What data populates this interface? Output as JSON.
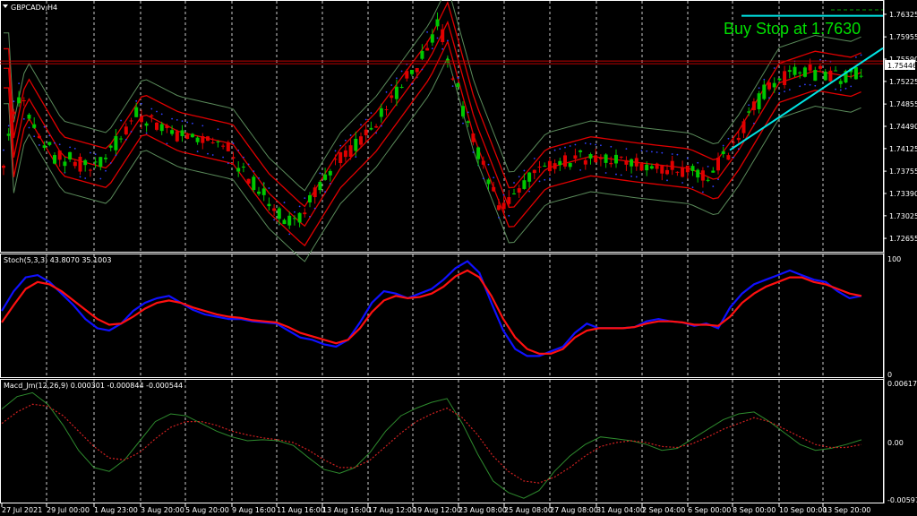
{
  "window": {
    "symbol_title": "GBPCADv,H4"
  },
  "annotation": {
    "text": "Buy Stop at 1.7630",
    "color": "#00e000"
  },
  "colors": {
    "bull": "#00c800",
    "bear": "#e00000",
    "bands_mid": "#e00000",
    "bands_outer": "#5a8a5a",
    "psar": "#3040ff",
    "trendline": "#00e5e5",
    "stoch_main": "#1010ff",
    "stoch_signal": "#ff1010",
    "grid": "#ffffff"
  },
  "chart_data": [
    {
      "type": "candlestick",
      "title": "GBPCADv,H4",
      "y_ticks": [
        "1.76325",
        "1.75955",
        "1.75590",
        "1.75225",
        "1.74855",
        "1.74490",
        "1.74125",
        "1.73755",
        "1.73390",
        "1.73025",
        "1.72655"
      ],
      "ylim": [
        1.7248,
        1.765
      ],
      "current_price": "1.75446",
      "resistance": 1.7556,
      "buy_stop": 1.763,
      "x_tick_labels": [
        "27 Jul 2021",
        "29 Jul 00:00",
        "1 Aug 23:00",
        "3 Aug 20:00",
        "5 Aug 20:00",
        "9 Aug 16:00",
        "11 Aug 16:00",
        "13 Aug 16:00",
        "17 Aug 12:00",
        "19 Aug 12:00",
        "23 Aug 08:00",
        "25 Aug 08:00",
        "27 Aug 08:00",
        "31 Aug 04:00",
        "2 Sep 04:00",
        "6 Sep 00:00",
        "8 Sep 00:00",
        "10 Sep 00:00",
        "13 Sep 20:00"
      ],
      "trendline": {
        "from": [
          "8 Sep 00:00",
          1.741
        ],
        "to": [
          "13 Sep 20:00",
          1.7562
        ]
      },
      "indicators": [
        "Bollinger Bands",
        "Parabolic SAR"
      ]
    },
    {
      "type": "line",
      "title": "Stoch(5,3,3) 43.8070 35.1003",
      "y_ticks": [
        "100",
        "0"
      ],
      "ylim": [
        0,
        100
      ],
      "series": [
        {
          "name": "main",
          "values": [
            55,
            72,
            84,
            86,
            80,
            70,
            60,
            48,
            40,
            38,
            44,
            55,
            62,
            66,
            68,
            62,
            56,
            52,
            50,
            48,
            48,
            46,
            45,
            44,
            38,
            32,
            30,
            26,
            24,
            30,
            45,
            62,
            72,
            70,
            66,
            70,
            74,
            82,
            92,
            98,
            88,
            62,
            38,
            22,
            16,
            16,
            20,
            24,
            36,
            44,
            40,
            40,
            40,
            41,
            46,
            48,
            46,
            45,
            42,
            44,
            40,
            58,
            70,
            78,
            82,
            86,
            90,
            86,
            82,
            80,
            72,
            66,
            68
          ]
        },
        {
          "name": "signal",
          "values": [
            45,
            60,
            74,
            80,
            78,
            72,
            64,
            56,
            48,
            43,
            44,
            50,
            57,
            62,
            64,
            62,
            58,
            55,
            52,
            50,
            49,
            47,
            46,
            45,
            41,
            36,
            33,
            30,
            27,
            30,
            40,
            54,
            64,
            68,
            66,
            67,
            70,
            76,
            85,
            90,
            84,
            68,
            48,
            32,
            22,
            18,
            18,
            22,
            32,
            38,
            40,
            40,
            40,
            41,
            44,
            46,
            46,
            45,
            43,
            43,
            42,
            50,
            62,
            70,
            76,
            80,
            84,
            84,
            80,
            78,
            74,
            70,
            68
          ]
        }
      ]
    },
    {
      "type": "line",
      "title": "Macd_Jm(12,26,9) 0.000301 -0.000844 -0.000544",
      "y_ticks": [
        "0.006176",
        "0.00",
        "-0.00597"
      ],
      "ylim": [
        -0.00597,
        0.006176
      ],
      "series": [
        {
          "name": "macd",
          "values": [
            0.0035,
            0.0048,
            0.0052,
            0.004,
            0.0018,
            -0.0008,
            -0.0026,
            -0.003,
            -0.0018,
            0.0002,
            0.0022,
            0.003,
            0.0028,
            0.002,
            0.0012,
            0.0006,
            0.0002,
            0.0003,
            0.0002,
            -0.0003,
            -0.0016,
            -0.0028,
            -0.0032,
            -0.0026,
            -0.001,
            0.0012,
            0.0028,
            0.0036,
            0.0042,
            0.0046,
            0.002,
            -0.0012,
            -0.004,
            -0.0052,
            -0.0058,
            -0.005,
            -0.003,
            -0.0014,
            -0.0002,
            0.0006,
            0.0004,
            0.0002,
            -0.0002,
            -0.0008,
            -0.0006,
            0.0004,
            0.0014,
            0.0024,
            0.003,
            0.0032,
            0.0022,
            0.001,
            -0.0002,
            -0.0008,
            -0.0006,
            -0.0002,
            0.0003
          ]
        },
        {
          "name": "signal",
          "values": [
            0.002,
            0.0032,
            0.004,
            0.0038,
            0.0028,
            0.0012,
            -0.0004,
            -0.0016,
            -0.0018,
            -0.001,
            0.0004,
            0.0016,
            0.0022,
            0.0022,
            0.0018,
            0.0012,
            0.0008,
            0.0005,
            0.0003,
            0.0,
            -0.0008,
            -0.0018,
            -0.0026,
            -0.0026,
            -0.0018,
            -0.0004,
            0.001,
            0.0022,
            0.003,
            0.0036,
            0.0026,
            0.0008,
            -0.0014,
            -0.003,
            -0.004,
            -0.0042,
            -0.0036,
            -0.0026,
            -0.0014,
            -0.0004,
            0.0,
            0.0002,
            0.0,
            -0.0004,
            -0.0005,
            -0.0001,
            0.0006,
            0.0014,
            0.002,
            0.0026,
            0.0022,
            0.0014,
            0.0006,
            -0.0002,
            -0.0005,
            -0.0005,
            -0.0002
          ]
        }
      ]
    }
  ]
}
